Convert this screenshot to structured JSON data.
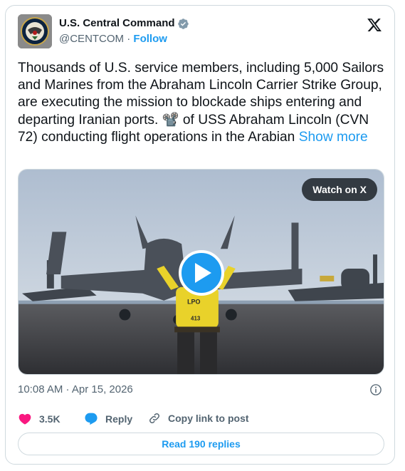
{
  "author": {
    "name": "U.S. Central Command",
    "handle": "@CENTCOM",
    "separator": "·",
    "follow_label": "Follow"
  },
  "post": {
    "text": "Thousands of U.S. service members, including 5,000 Sailors and Marines from the Abraham Lincoln Carrier Strike Group, are executing the mission to blockade ships entering and departing Iranian ports. 📽️ of USS Abraham Lincoln (CVN 72) conducting flight operations in the Arabian",
    "show_more_label": "Show more",
    "timestamp": "10:08 AM · Apr 15, 2026"
  },
  "media": {
    "watch_label": "Watch on X",
    "vest_text_1": "LPO",
    "vest_text_2": "413"
  },
  "actions": {
    "likes": "3.5K",
    "reply_label": "Reply",
    "copy_label": "Copy link to post"
  },
  "footer": {
    "read_replies_label": "Read 190 replies"
  },
  "colors": {
    "accent": "#1d9bf0",
    "like": "#f91880",
    "verified": "#829aab"
  }
}
